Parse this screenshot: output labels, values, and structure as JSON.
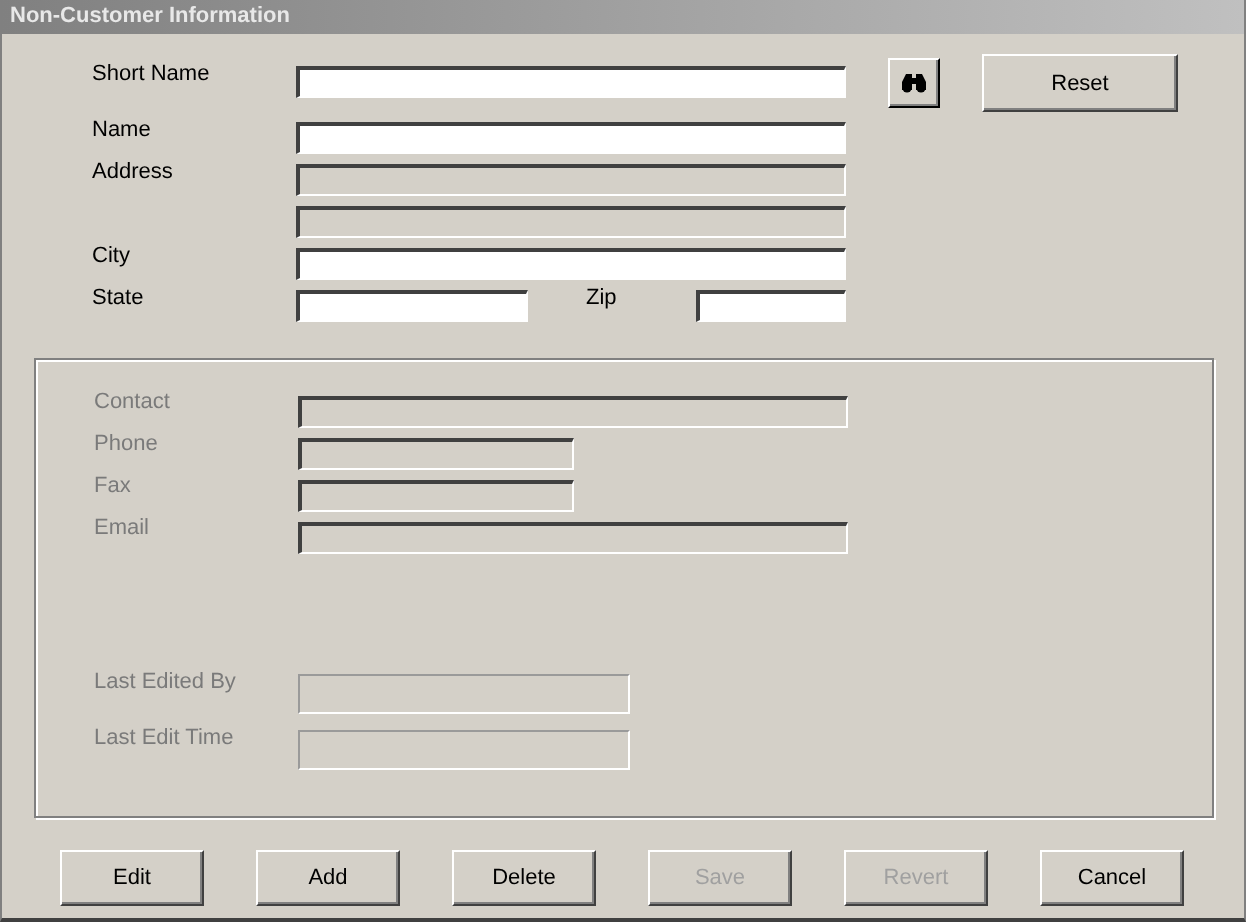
{
  "window": {
    "title": "Non-Customer Information"
  },
  "top_fields": [
    {
      "label": "Short Name",
      "kind": "long",
      "disabled": false
    },
    {
      "label": "Name",
      "kind": "long",
      "disabled": false
    },
    {
      "label": "Address",
      "kind": "long",
      "disabled": true
    },
    {
      "kind": "long",
      "disabled": true
    },
    {
      "label": "City",
      "kind": "long",
      "disabled": false
    }
  ],
  "state": {
    "label": "State",
    "disabled": false
  },
  "zip": {
    "label": "Zip",
    "disabled": false
  },
  "reset_button": {
    "label": "Reset"
  },
  "contact_fields": [
    {
      "label": "Contact",
      "kind": "long",
      "disabled": true
    },
    {
      "label": "Phone",
      "kind": "short",
      "disabled": true
    },
    {
      "label": "Fax",
      "kind": "short",
      "disabled": true
    },
    {
      "label": "Email",
      "kind": "long",
      "disabled": true
    }
  ],
  "audit_fields": [
    {
      "label": "Last Edited By",
      "kind": "medium",
      "disabled": true
    },
    {
      "label": "Last Edit Time",
      "kind": "medium",
      "disabled": true
    }
  ],
  "buttons": [
    {
      "label": "Edit",
      "disabled": false
    },
    {
      "label": "Add",
      "disabled": false
    },
    {
      "label": "Delete",
      "disabled": false
    },
    {
      "label": "Save",
      "disabled": true
    },
    {
      "label": "Revert",
      "disabled": true
    },
    {
      "label": "Cancel",
      "disabled": false
    }
  ]
}
